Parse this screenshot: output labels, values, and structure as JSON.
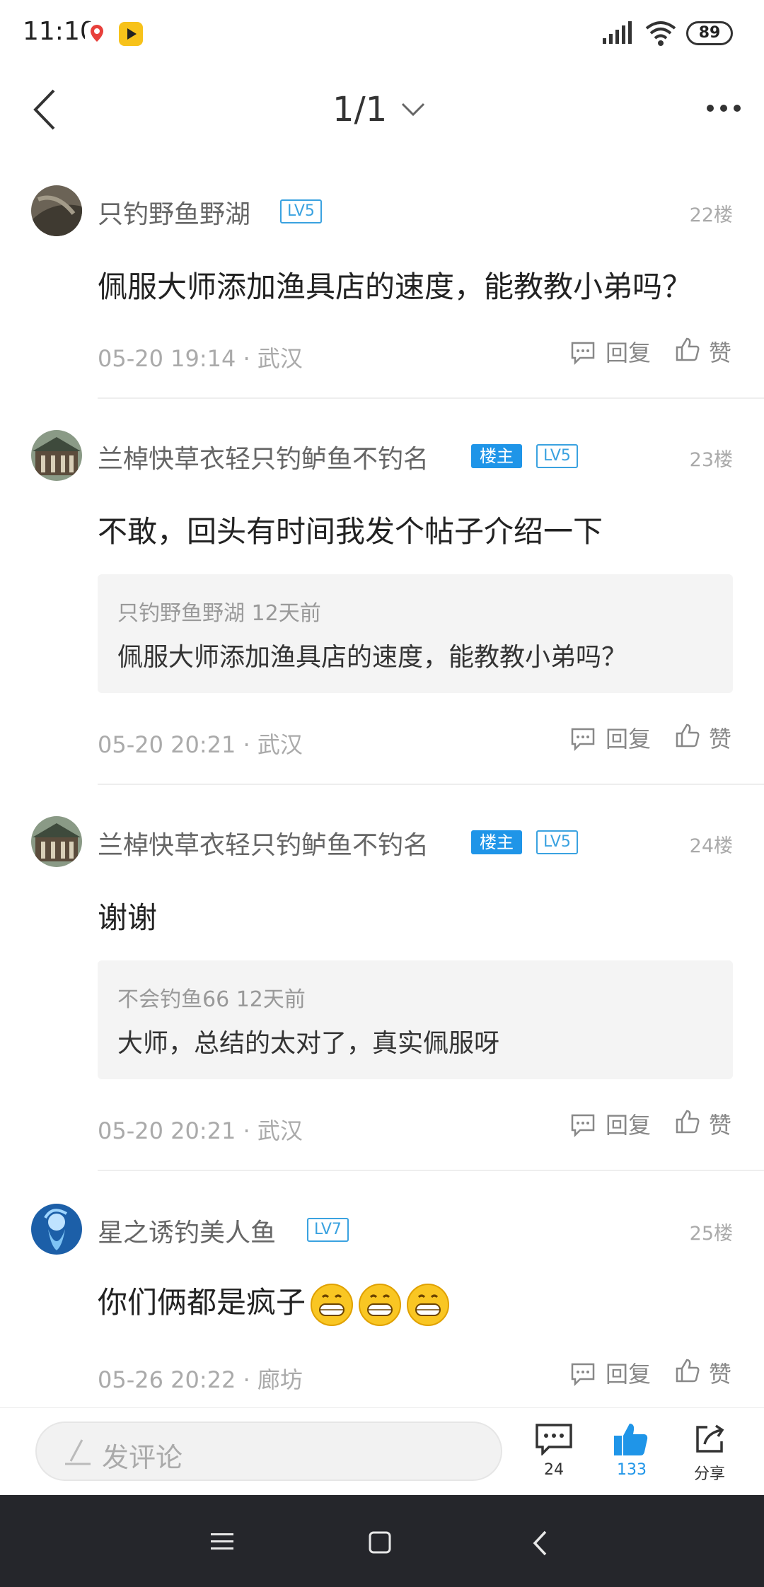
{
  "status_bar": {
    "time": "11:10",
    "battery": "89",
    "icons": [
      "map-pin-app-icon",
      "video-app-icon",
      "signal-icon",
      "wifi-icon",
      "battery-icon"
    ]
  },
  "header": {
    "page_indicator": "1/1"
  },
  "comments": [
    {
      "username": "只钓野鱼野湖",
      "level": "LV5",
      "floor": "22楼",
      "content": "佩服大师添加渔具店的速度，能教教小弟吗？",
      "meta": "05-20 19:14 · 武汉",
      "reply_label": "回复",
      "like_label": "赞"
    },
    {
      "username": "兰棹快草衣轻只钓鲈鱼不钓名",
      "owner_badge": "楼主",
      "level": "LV5",
      "floor": "23楼",
      "content": "不敢，回头有时间我发个帖子介绍一下",
      "quote": {
        "meta": "只钓野鱼野湖 12天前",
        "text": "佩服大师添加渔具店的速度，能教教小弟吗？"
      },
      "meta": "05-20 20:21 · 武汉",
      "reply_label": "回复",
      "like_label": "赞"
    },
    {
      "username": "兰棹快草衣轻只钓鲈鱼不钓名",
      "owner_badge": "楼主",
      "level": "LV5",
      "floor": "24楼",
      "content": "谢谢",
      "quote": {
        "meta": "不会钓鱼66 12天前",
        "text": "大师，总结的太对了，真实佩服呀"
      },
      "meta": "05-20 20:21 · 武汉",
      "reply_label": "回复",
      "like_label": "赞"
    },
    {
      "username": "星之诱钓美人鱼",
      "level": "LV7",
      "floor": "25楼",
      "content": "你们俩都是疯子",
      "emoji_count": 3,
      "meta": "05-26 20:22 · 廊坊",
      "reply_label": "回复",
      "like_label": "赞"
    }
  ],
  "bottom_bar": {
    "input_placeholder": "发评论",
    "comments_count": "24",
    "likes_count": "133",
    "share_label": "分享"
  },
  "colors": {
    "accent": "#1f95e8",
    "level_badge": "#3aa2e0",
    "nav_bar": "#25262b"
  }
}
